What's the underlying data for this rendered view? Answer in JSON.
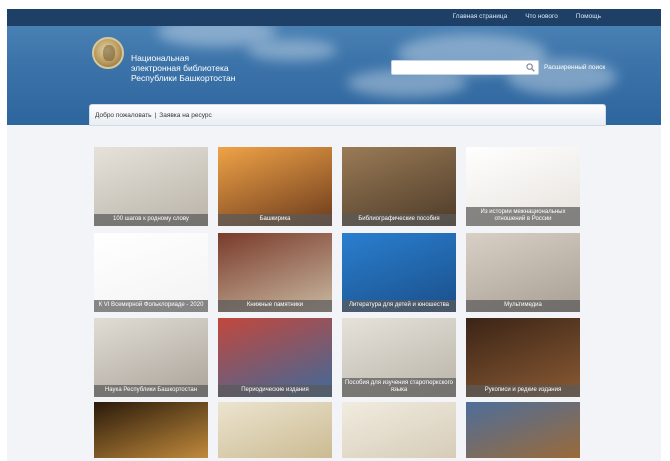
{
  "header": {
    "nav": [
      "Главная страница",
      "Что нового",
      "Помощь"
    ],
    "title_lines": [
      "Национальная",
      "электронная библиотека",
      "Республики Башкортостан"
    ],
    "search_placeholder": "",
    "advanced_search": "Расширенный поиск"
  },
  "breadcrumbs": [
    "Добро пожаловать",
    "|",
    "Заявка на ресурс"
  ],
  "tiles": [
    {
      "caption": "100 шагов к родному слову",
      "icon": "open-book-image",
      "bg": [
        "#e6e2da",
        "#b9b3a8"
      ]
    },
    {
      "caption": "Башкирика",
      "icon": "horseman-monument-sunset-image",
      "bg": [
        "#f0a347",
        "#6b3a1c"
      ]
    },
    {
      "caption": "Библиографические пособия",
      "icon": "book-covers-image",
      "bg": [
        "#9a7b56",
        "#4d3b29"
      ]
    },
    {
      "caption": "Из истории межнациональных отношений в России",
      "icon": "people-circle-image",
      "bg": [
        "#ffffff",
        "#e7e3dd"
      ]
    },
    {
      "caption": "К VI Всемирной Фольклориаде - 2020",
      "icon": "folkloriada-logo-image",
      "bg": [
        "#ffffff",
        "#f3f3f3"
      ]
    },
    {
      "caption": "Книжные памятники",
      "icon": "old-books-shelf-image",
      "bg": [
        "#7a3a2a",
        "#c9b9a1"
      ]
    },
    {
      "caption": "Литература для детей и юношества",
      "icon": "raised-hands-image",
      "bg": [
        "#2a7fd0",
        "#1a4f8a"
      ]
    },
    {
      "caption": "Мультимедиа",
      "icon": "vinyl-record-image",
      "bg": [
        "#d8d0c6",
        "#a99f94"
      ]
    },
    {
      "caption": "Наука Республики Башкортостан",
      "icon": "scientific-books-image",
      "bg": [
        "#e2ddd4",
        "#a9a39a"
      ]
    },
    {
      "caption": "Периодические издания",
      "icon": "magazines-image",
      "bg": [
        "#c2473c",
        "#3e6a9b"
      ]
    },
    {
      "caption": "Пособия для изучения старотюркского языка",
      "icon": "open-book-image",
      "bg": [
        "#e6e2da",
        "#b9b3a8"
      ]
    },
    {
      "caption": "Рукописи и редкие издания",
      "icon": "leather-books-image",
      "bg": [
        "#3b2416",
        "#8a5a34"
      ]
    },
    {
      "caption": "",
      "icon": "candle-book-image",
      "bg": [
        "#2a1a0a",
        "#c08a3c"
      ]
    },
    {
      "caption": "",
      "icon": "portrait-man-image",
      "bg": [
        "#ece4cf",
        "#cbbb93"
      ]
    },
    {
      "caption": "",
      "icon": "mosque-sketch-image",
      "bg": [
        "#f1ece0",
        "#d6ccb8"
      ]
    },
    {
      "caption": "",
      "icon": "painting-crowd-image",
      "bg": [
        "#4d6e9a",
        "#9a6a3a"
      ]
    }
  ]
}
